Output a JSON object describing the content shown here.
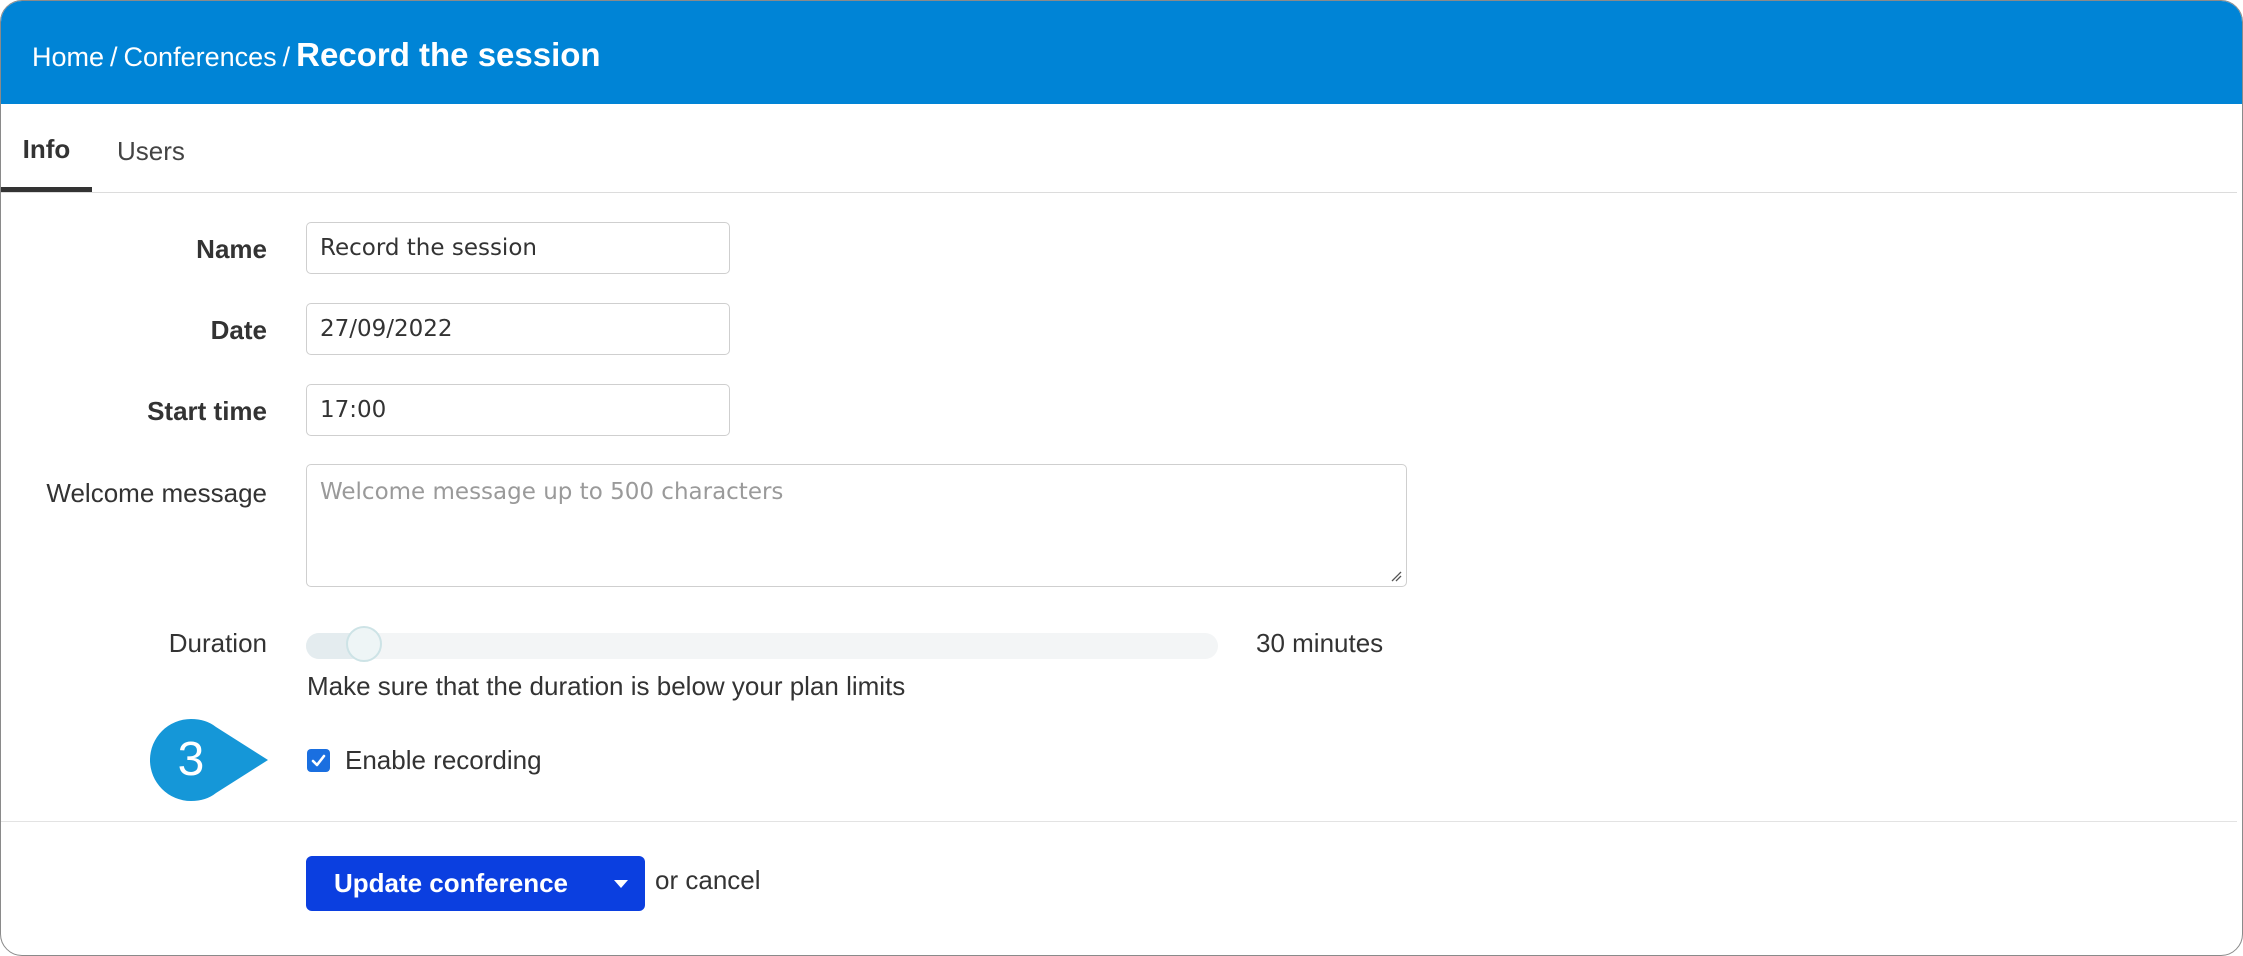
{
  "header": {
    "breadcrumb": {
      "home": "Home",
      "separator": "/",
      "conferences": "Conferences",
      "current": "Record the session"
    },
    "background_color": "#0084d6"
  },
  "tabs": [
    {
      "label": "Info",
      "active": true
    },
    {
      "label": "Users",
      "active": false
    }
  ],
  "form": {
    "name": {
      "label": "Name",
      "value": "Record the session"
    },
    "date": {
      "label": "Date",
      "value": "27/09/2022"
    },
    "start_time": {
      "label": "Start time",
      "value": "17:00"
    },
    "welcome_message": {
      "label": "Welcome message",
      "value": "",
      "placeholder": "Welcome message up to 500 characters"
    },
    "duration": {
      "label": "Duration",
      "value_text": "30 minutes",
      "slider_level": 0.03,
      "hint": "Make sure that the duration is below your plan limits"
    },
    "enable_recording": {
      "label": "Enable recording",
      "checked": true
    }
  },
  "step_badge": {
    "number": "3",
    "color": "#1597d8"
  },
  "actions": {
    "submit_label": "Update conference",
    "or_text": "or",
    "cancel_label": "cancel",
    "button_color": "#0b3fe0"
  }
}
